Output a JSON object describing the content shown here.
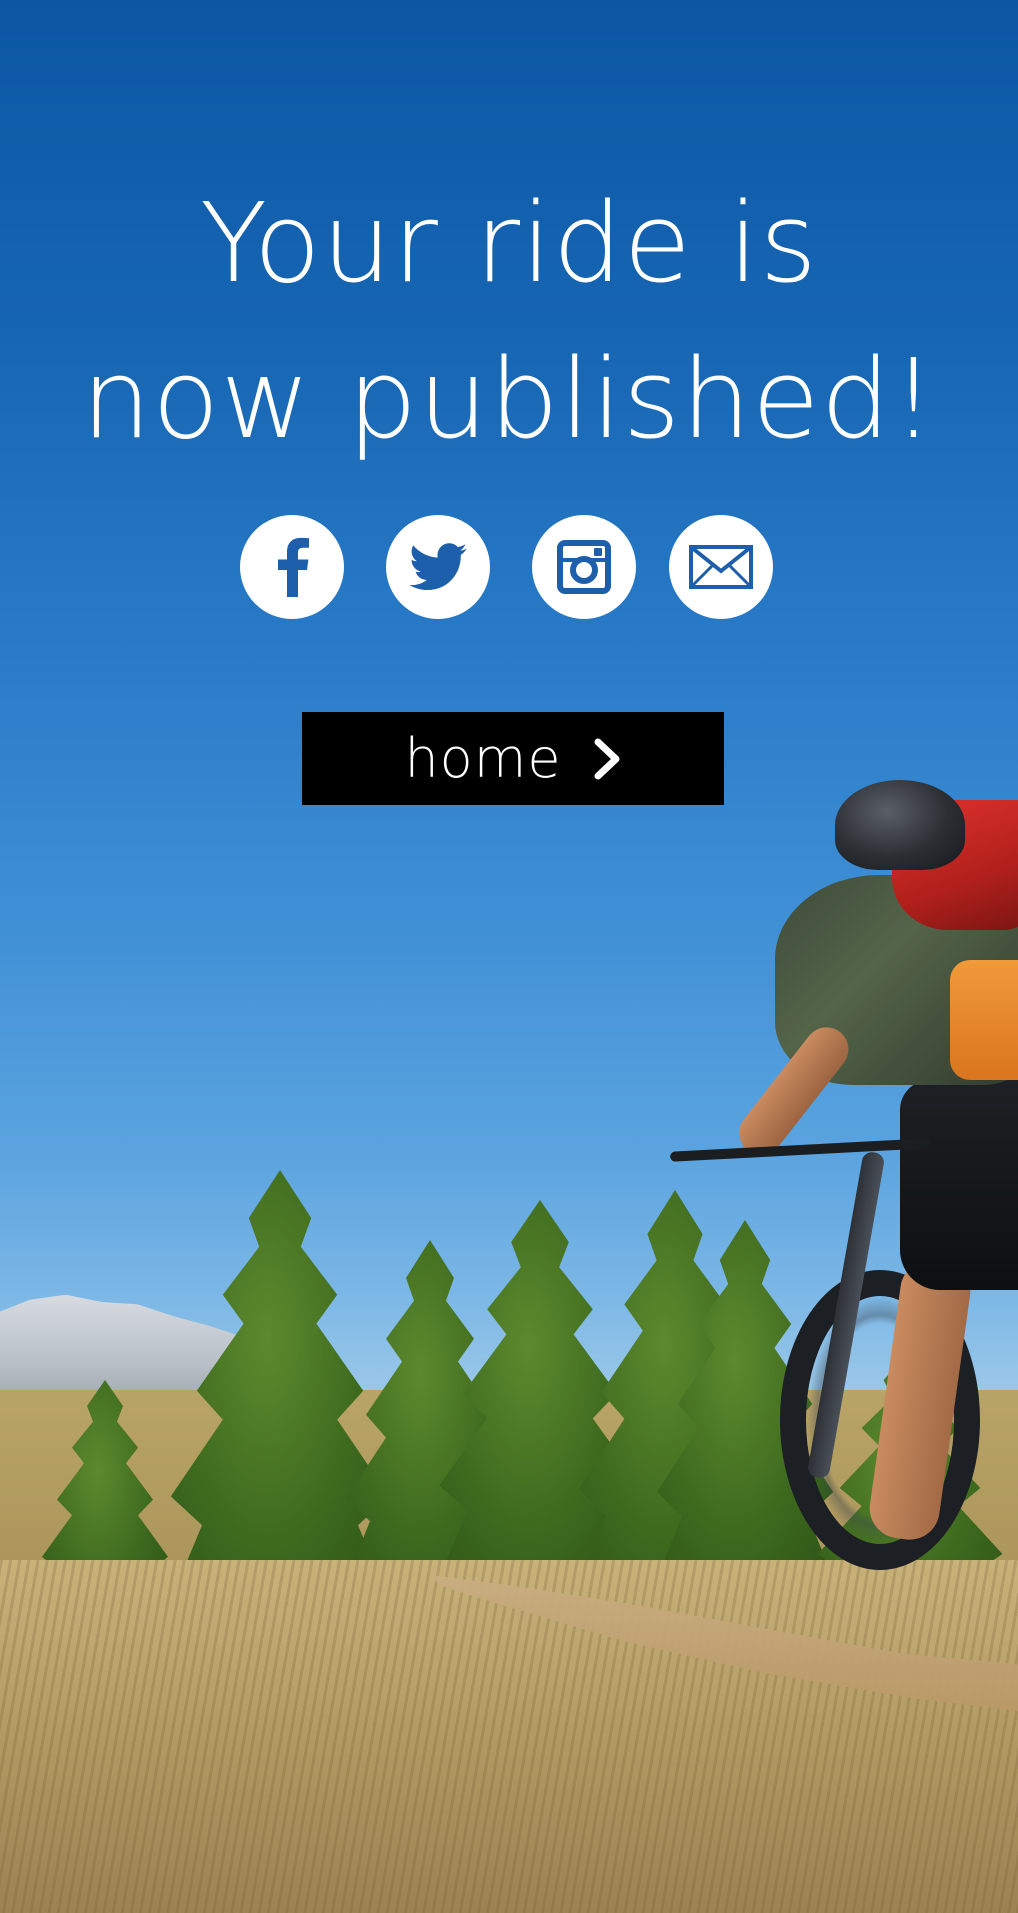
{
  "headline": {
    "line1": "Your ride is",
    "line2": "now published!"
  },
  "share": {
    "items": [
      {
        "name": "facebook",
        "icon": "facebook-icon"
      },
      {
        "name": "twitter",
        "icon": "twitter-icon"
      },
      {
        "name": "instagram",
        "icon": "instagram-icon"
      },
      {
        "name": "email",
        "icon": "mail-icon"
      }
    ],
    "icon_color": "#1d5fab"
  },
  "home_button": {
    "label": "home",
    "icon": "chevron-right-icon"
  },
  "colors": {
    "sky_top": "#0b57a4",
    "sky_bottom": "#b8d6e8",
    "button_bg": "#000000",
    "text": "#ffffff"
  }
}
